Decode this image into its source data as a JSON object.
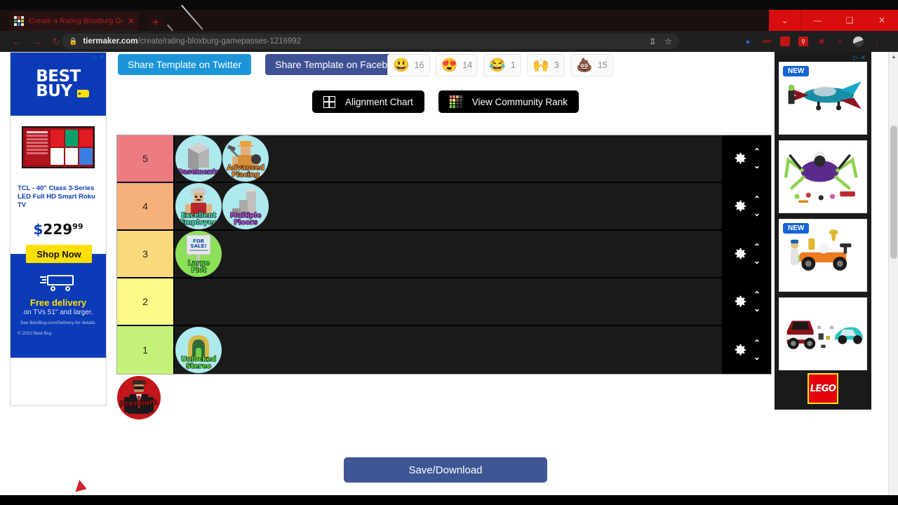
{
  "browser": {
    "tab": {
      "title": "Create a Rating Bloxburg Gamep",
      "close_label": "✕"
    },
    "newtab_label": "+",
    "window_controls": {
      "dropdown": "⌄",
      "minimize": "—",
      "maximize": "❑",
      "close": "✕"
    },
    "nav": {
      "back": "←",
      "forward": "→",
      "reload": "↻"
    },
    "omnibox": {
      "lock_icon": "🔒",
      "domain": "tiermaker.com",
      "path": "/create/rating-bloxburg-gamepasses-1216992"
    },
    "omni_icons": {
      "share": "⇪",
      "bookmark": "☆"
    },
    "extensions": [
      "cursor-icon",
      "ad-block-icon",
      "roblox-icon",
      "roblox-search-icon",
      "puzzle-icon",
      "list-icon",
      "profile-avatar",
      "menu-kebab"
    ]
  },
  "left_ad": {
    "adchoices_label": "▷",
    "close_label": "✕",
    "brand": "BEST BUY",
    "product_title": "TCL - 40\" Class 3-Series LED Full HD Smart Roku TV",
    "price_currency": "$",
    "price_dollars": "229",
    "price_cents": "99",
    "cta": "Shop Now",
    "delivery_headline": "Free delivery",
    "delivery_sub": "on TVs 51\" and larger.",
    "fine_print": "See BestBuy.com/Delivery for details.",
    "copyright": "© 2022 Best Buy"
  },
  "right_ad": {
    "adchoices_label": "▷",
    "close_label": "✕",
    "cards": [
      {
        "badge": "NEW",
        "art": "stunt-plane"
      },
      {
        "badge": "",
        "art": "spider-mech"
      },
      {
        "badge": "NEW",
        "art": "race-car"
      },
      {
        "badge": "",
        "art": "truck-and-sportscar"
      }
    ],
    "brand_logo": "LEGO"
  },
  "main": {
    "share_twitter": "Share Template on Twitter",
    "share_facebook": "Share Template on Facebook",
    "reactions": [
      {
        "icon": "😃",
        "name": "grinning-face",
        "count": "16"
      },
      {
        "icon": "😍",
        "name": "heart-eyes-face",
        "count": "14"
      },
      {
        "icon": "😂",
        "name": "tears-of-joy-face",
        "count": "1"
      },
      {
        "icon": "🙌",
        "name": "raising-hands",
        "count": "3"
      },
      {
        "icon": "💩",
        "name": "pile-of-poo",
        "count": "15"
      }
    ],
    "alignment_chart": "Alignment Chart",
    "view_community_rank": "View Community Rank",
    "save_download": "Save/Download",
    "gear_label": "row-settings",
    "chevron_up": "⌃",
    "chevron_down": "⌄"
  },
  "tiers": [
    {
      "label": "5",
      "color": "#ec7b82",
      "items": [
        {
          "name": "Basements",
          "lines": [
            "Basements"
          ],
          "text_color": "#b14fe0",
          "bg": "#aee9ee",
          "art": "grey-box"
        },
        {
          "name": "Advanced Placing",
          "lines": [
            "Advanced",
            "Placing"
          ],
          "text_color": "#f08a2a",
          "bg": "#aee9ee",
          "art": "builder-figure"
        }
      ]
    },
    {
      "label": "4",
      "color": "#f6b079",
      "items": [
        {
          "name": "Excellent Employee",
          "lines": [
            "Excellent",
            "Employee"
          ],
          "text_color": "#4fe0b6",
          "bg": "#aee9ee",
          "art": "employee-figure"
        },
        {
          "name": "Multiple Floors",
          "lines": [
            "Multiple",
            "Floors"
          ],
          "text_color": "#b14fe0",
          "bg": "#aee9ee",
          "art": "grey-stairs"
        }
      ]
    },
    {
      "label": "3",
      "color": "#f8d97c",
      "items": [
        {
          "name": "Large Plot",
          "lines": [
            "Large",
            "Plot"
          ],
          "text_color": "#58e23d",
          "bg": "#8ce05a",
          "art": "for-sale-sign"
        }
      ]
    },
    {
      "label": "2",
      "color": "#fcfa88",
      "items": []
    },
    {
      "label": "1",
      "color": "#c4f278",
      "items": [
        {
          "name": "Unlocked Stereo",
          "lines": [
            "Unlocked",
            "Stereo"
          ],
          "text_color": "#58e23d",
          "bg": "#aee9ee",
          "art": "stereo"
        }
      ]
    }
  ],
  "unranked": [
    {
      "name": "Premium",
      "lines": [
        "Premium"
      ],
      "text_color": "#8a1a1a",
      "bg": "#c1161c",
      "art": "premium-figure"
    }
  ]
}
